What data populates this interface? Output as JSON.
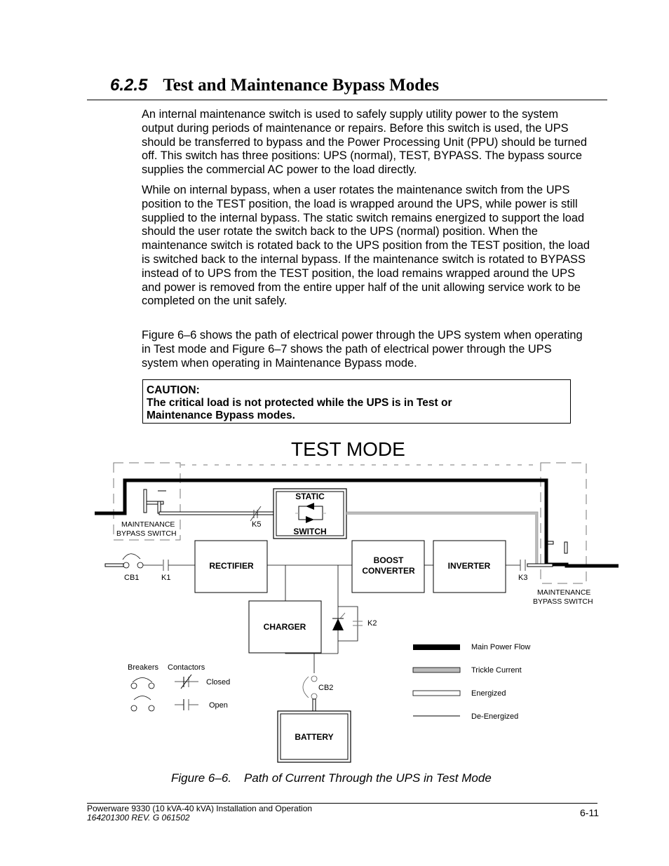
{
  "section": {
    "number": "6.2.5",
    "title": "Test and Maintenance Bypass Modes"
  },
  "paragraphs": [
    "An internal maintenance switch is used to safely supply utility power to the system output during periods of maintenance or repairs.  Before this switch is used, the UPS should be transferred to bypass and the Power Processing Unit (PPU) should be turned off.  This switch has three positions: UPS (normal), TEST, BYPASS.  The bypass source supplies the commercial AC power to the load directly.",
    "While on internal bypass, when a user rotates the maintenance switch from the UPS position to the TEST position, the load is wrapped around the UPS, while power is still supplied to the internal bypass.  The static switch remains energized to support the load should the user rotate the switch back to the UPS (normal) position.  When the maintenance switch is rotated back to the UPS position from the TEST position, the load is switched back to the internal bypass.  If the maintenance switch is rotated to BYPASS instead of to UPS from the TEST position, the load remains wrapped around the UPS and power is removed from the entire upper half of the unit allowing service work to be completed on the unit safely.",
    "Figure 6–6 shows the path of electrical power through the UPS system when operating in Test mode and Figure 6–7 shows the path of electrical power through the UPS system when operating in Maintenance Bypass mode."
  ],
  "caution": {
    "label": "CAUTION:",
    "line1": "The critical load is not protected while the UPS is in Test or",
    "line2": "Maintenance Bypass modes."
  },
  "diagram": {
    "title": "TEST MODE",
    "blocks": {
      "static_switch_top": "STATIC",
      "static_switch_bottom": "SWITCH",
      "rectifier": "RECTIFIER",
      "boost_top": "BOOST",
      "boost_bottom": "CONVERTER",
      "inverter": "INVERTER",
      "charger": "CHARGER",
      "battery": "BATTERY"
    },
    "labels": {
      "mbs_left_1": "MAINTENANCE",
      "mbs_left_2": "BYPASS SWITCH",
      "mbs_right_1": "MAINTENANCE",
      "mbs_right_2": "BYPASS SWITCH",
      "k5": "K5",
      "cb1": "CB1",
      "k1": "K1",
      "k3": "K3",
      "k2": "K2",
      "cb2": "CB2"
    },
    "symbol_key": {
      "breakers": "Breakers",
      "contactors": "Contactors",
      "closed": "Closed",
      "open": "Open"
    },
    "legend": [
      {
        "label": "Main Power Flow",
        "style": "main"
      },
      {
        "label": "Trickle Current",
        "style": "trickle"
      },
      {
        "label": "Energized",
        "style": "energized"
      },
      {
        "label": "De-Energized",
        "style": "deenergized"
      }
    ],
    "colors": {
      "main": "#000000",
      "trickle": "#bbbbbb",
      "dashed_enclosure": "#777777"
    }
  },
  "caption": {
    "figure": "Figure 6–6.",
    "text": "Path of Current Through the UPS in Test Mode"
  },
  "footer": {
    "line1": "Powerware 9330 (10 kVA-40 kVA) Installation and Operation",
    "line2": "164201300 REV. G  061502",
    "page": "6-11"
  }
}
